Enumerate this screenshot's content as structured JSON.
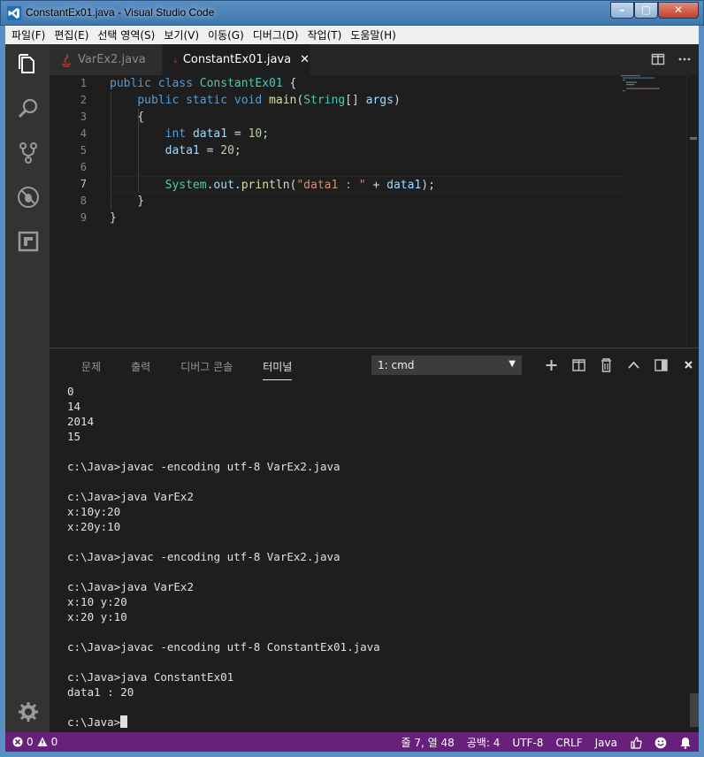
{
  "window": {
    "title": "ConstantEx01.java - Visual Studio Code",
    "minimize_glyph": "–",
    "maximize_glyph": "▢",
    "close_glyph": "✕"
  },
  "menubar": {
    "items": [
      "파일(F)",
      "편집(E)",
      "선택 영역(S)",
      "보기(V)",
      "이동(G)",
      "디버그(D)",
      "작업(T)",
      "도움말(H)"
    ]
  },
  "activity_icons": [
    "files-icon",
    "search-icon",
    "source-control-icon",
    "debug-icon",
    "extensions-icon",
    "gear-icon"
  ],
  "tabs": [
    {
      "label": "VarEx2.java",
      "active": false
    },
    {
      "label": "ConstantEx01.java",
      "active": true,
      "close": "✕"
    }
  ],
  "editor": {
    "line_numbers": [
      "1",
      "2",
      "3",
      "4",
      "5",
      "6",
      "7",
      "8",
      "9"
    ],
    "current_line": 7
  },
  "panel": {
    "tabs": [
      "문제",
      "출력",
      "디버그 콘솔",
      "터미널"
    ],
    "active_tab": "터미널",
    "terminal_select": "1: cmd",
    "terminal_lines": [
      "0",
      "14",
      "2014",
      "15",
      "",
      "c:\\Java>javac -encoding utf-8 VarEx2.java",
      "",
      "c:\\Java>java VarEx2",
      "x:10y:20",
      "x:20y:10",
      "",
      "c:\\Java>javac -encoding utf-8 VarEx2.java",
      "",
      "c:\\Java>java VarEx2",
      "x:10 y:20",
      "x:20 y:10",
      "",
      "c:\\Java>javac -encoding utf-8 ConstantEx01.java",
      "",
      "c:\\Java>java ConstantEx01",
      "data1 : 20",
      ""
    ],
    "prompt": "c:\\Java>"
  },
  "statusbar": {
    "errors": "0",
    "warnings": "0",
    "position": "줄 7, 열 48",
    "spaces": "공백: 4",
    "encoding": "UTF-8",
    "eol": "CRLF",
    "language": "Java",
    "color": "#68217a"
  }
}
